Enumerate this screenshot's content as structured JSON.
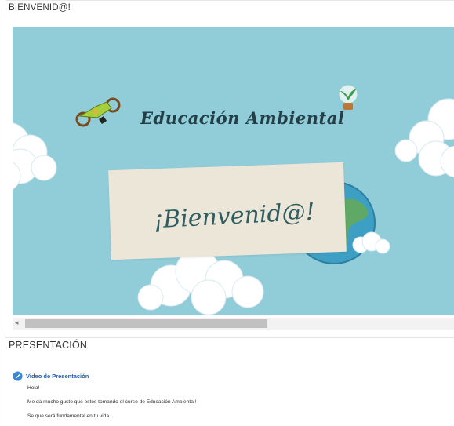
{
  "welcome_section": {
    "title": "BIENVENID@!",
    "banner": {
      "heading": "Educación Ambiental",
      "greeting": "¡Bienvenid@!",
      "background_color": "#91ccd9"
    },
    "scrollbar": {
      "left_arrow": "◂",
      "right_arrow": "▸"
    }
  },
  "presentation_section": {
    "title": "PRESENTACIÓN",
    "video_link": {
      "icon": "video-icon",
      "label": "Video de Presentación"
    },
    "paragraphs": [
      "Hola!",
      "Me da mucho gusto que estés tomando el curso de Educación Ambiental!",
      "Se que será fundamental en tu vida."
    ]
  },
  "colors": {
    "link": "#1f5fb5",
    "earth_ocean": "#3d9fc4",
    "earth_land": "#5fa865"
  }
}
